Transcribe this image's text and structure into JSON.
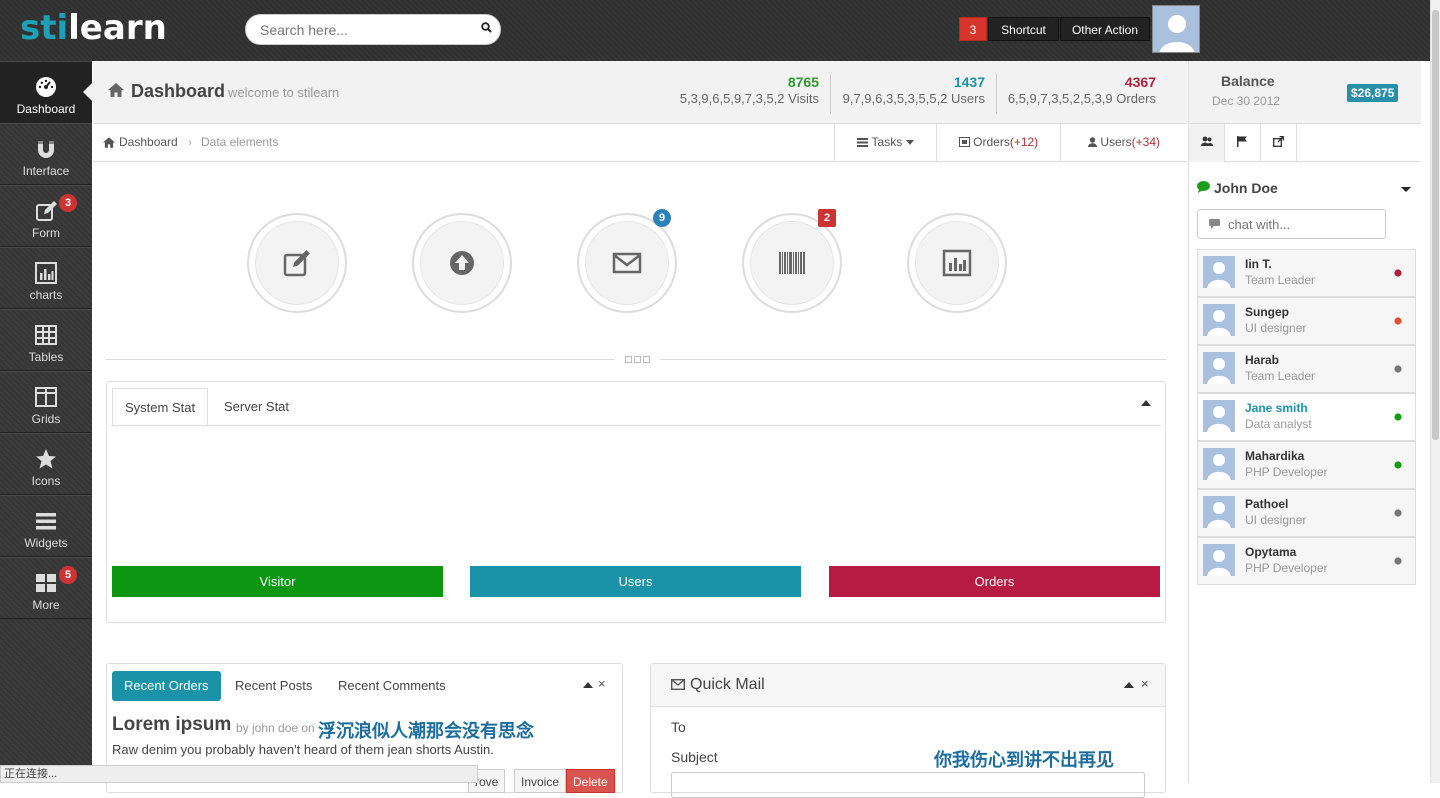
{
  "app": {
    "logo_part1": "sti",
    "logo_part2": "learn"
  },
  "search": {
    "placeholder": "Search here..."
  },
  "topbar": {
    "notification_count": "3",
    "shortcut_label": "Shortcut",
    "other_action_label": "Other Action"
  },
  "sidebar": {
    "items": [
      {
        "label": "Dashboard",
        "icon": "dashboard-icon",
        "active": true
      },
      {
        "label": "Interface",
        "icon": "magnet-icon"
      },
      {
        "label": "Form",
        "icon": "edit-icon",
        "badge": "3"
      },
      {
        "label": "charts",
        "icon": "bar-chart-icon"
      },
      {
        "label": "Tables",
        "icon": "table-icon"
      },
      {
        "label": "Grids",
        "icon": "grid-icon"
      },
      {
        "label": "Icons",
        "icon": "star-icon"
      },
      {
        "label": "Widgets",
        "icon": "list-icon"
      },
      {
        "label": "More",
        "icon": "tiles-icon",
        "badge": "5"
      }
    ]
  },
  "header": {
    "title": "Dashboard",
    "subtitle": "welcome to stilearn",
    "stats": [
      {
        "value": "8765",
        "sparkline": "5,3,9,6,5,9,7,3,5,2",
        "label": "Visits",
        "color": "#2e9a2e"
      },
      {
        "value": "1437",
        "sparkline": "9,7,9,6,3,5,3,5,5,2",
        "label": "Users",
        "color": "#1a93a8"
      },
      {
        "value": "4367",
        "sparkline": "6,5,9,7,3,5,2,5,3,9",
        "label": "Orders",
        "color": "#b0203e"
      }
    ]
  },
  "breadcrumb": {
    "home": "Dashboard",
    "separator": "›",
    "current": "Data elements"
  },
  "quick_buttons": {
    "tasks_label": "Tasks",
    "orders_label": "Orders",
    "orders_count": "(+12)",
    "users_label": "Users",
    "users_count": "(+34)"
  },
  "shortcuts": [
    {
      "icon": "edit-icon"
    },
    {
      "icon": "upload-icon"
    },
    {
      "icon": "envelope-icon",
      "badge": "9",
      "badge_color": "#2b82b8"
    },
    {
      "icon": "barcode-icon",
      "badge": "2",
      "badge_color": "#c33"
    },
    {
      "icon": "bar-chart-icon"
    }
  ],
  "stat_panel": {
    "tabs": [
      "System Stat",
      "Server Stat"
    ],
    "bars": [
      {
        "label": "Visitor",
        "color": "#0c9611"
      },
      {
        "label": "Users",
        "color": "#1a93a8"
      },
      {
        "label": "Orders",
        "color": "#b71a43"
      }
    ]
  },
  "recent": {
    "tabs": [
      "Recent Orders",
      "Recent Posts",
      "Recent Comments"
    ],
    "title": "Lorem ipsum",
    "byline": "by john doe on",
    "text": "Raw denim you probably haven't heard of them jean shorts Austin.",
    "buttons": [
      "rove",
      "Invoice",
      "Delete"
    ]
  },
  "quick_mail": {
    "title": "Quick Mail",
    "to_label": "To",
    "subject_label": "Subject"
  },
  "balance": {
    "title": "Balance",
    "date": "Dec 30 2012",
    "amount": "$26,875"
  },
  "chat": {
    "user": "John Doe",
    "placeholder": "chat with...",
    "contacts": [
      {
        "name": "Iin T.",
        "role": "Team Leader",
        "status": "#b0203e"
      },
      {
        "name": "Sungep",
        "role": "UI designer",
        "status": "#e0522d"
      },
      {
        "name": "Harab",
        "role": "Team Leader",
        "status": "#777777"
      },
      {
        "name": "Jane smith",
        "role": "Data analyst",
        "status": "#12a012"
      },
      {
        "name": "Mahardika",
        "role": "PHP Developer",
        "status": "#12a012"
      },
      {
        "name": "Pathoel",
        "role": "UI designer",
        "status": "#777777"
      },
      {
        "name": "Opytama",
        "role": "PHP Developer",
        "status": "#777777"
      }
    ]
  },
  "statusbar": {
    "text": "正在连接..."
  },
  "overlays": {
    "line1": "浮沉浪似人潮那会没有思念",
    "line2": "你我伤心到讲不出再见"
  }
}
